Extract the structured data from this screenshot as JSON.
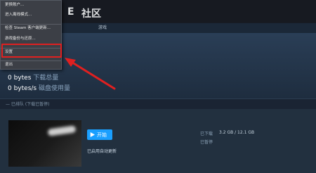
{
  "nav": {
    "item_partial": "E",
    "community_label": "社区"
  },
  "subbar": {
    "label": "游戏"
  },
  "stats": [
    {
      "value": "0 bytes",
      "label": "下载总量"
    },
    {
      "value": "0 bytes/s",
      "label": "磁盘使用量"
    }
  ],
  "queue": {
    "header": "— 已排队 (下载已暂停)"
  },
  "game": {
    "play_label": "开始",
    "update_note": "已启用自动更新",
    "size_label": "已下载",
    "size_value": "3.2 GB / 12.1 GB",
    "status_label": "已暂停"
  },
  "menu": {
    "items": [
      {
        "label": "更换账户..."
      },
      {
        "label": "进入离线模式..."
      },
      {
        "label": "检查 Steam 客户端更新..."
      },
      {
        "label": "游戏备份与还原..."
      },
      {
        "label": "设置"
      },
      {
        "label": "退出"
      }
    ]
  },
  "colors": {
    "highlight": "#e02020",
    "accent": "#1a9fff"
  }
}
